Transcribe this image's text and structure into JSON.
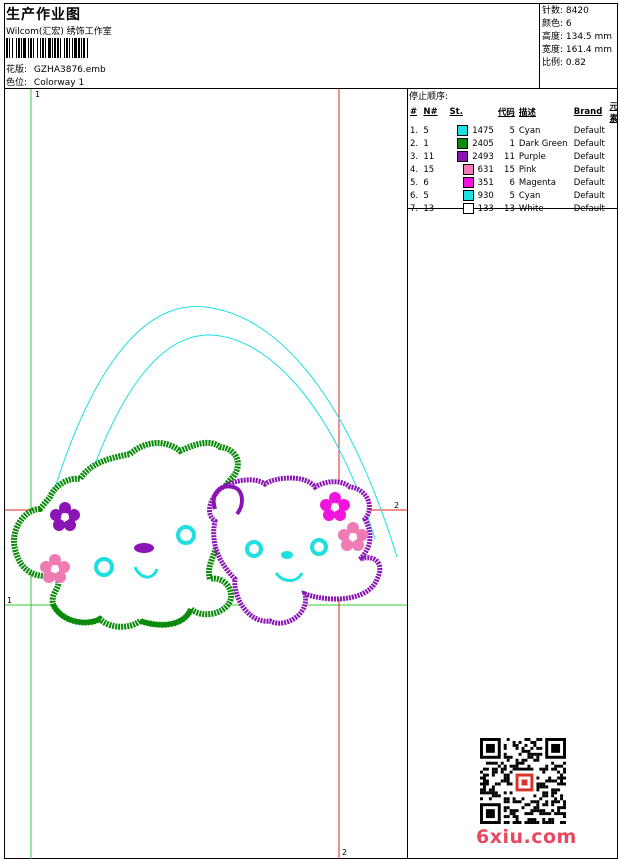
{
  "header": {
    "title": "生产作业图",
    "company": "Wilcom(汇宏) 绣饰工作室",
    "design_label": "花版:",
    "design_value": "GZHA3876.emb",
    "colorway_label": "色位:",
    "colorway_value": "Colorway 1"
  },
  "stats": {
    "stitches": "针数: 8420",
    "colors": "颜色: 6",
    "height": "高度: 134.5 mm",
    "width": "宽度: 161.4 mm",
    "scale": "比例: 0.82"
  },
  "stop_sequence": {
    "title": "停止顺序:",
    "headers": [
      "#",
      "N#",
      "St.",
      "代码",
      "描述",
      "Brand",
      "元素"
    ],
    "rows": [
      {
        "idx": "1.",
        "n": "5",
        "color": "#1ee0e0",
        "st": "1475",
        "code": "5",
        "desc": "Cyan",
        "brand": "Default"
      },
      {
        "idx": "2.",
        "n": "1",
        "color": "#0a8a0a",
        "st": "2405",
        "code": "1",
        "desc": "Dark Green",
        "brand": "Default"
      },
      {
        "idx": "3.",
        "n": "11",
        "color": "#8a14b4",
        "st": "2493",
        "code": "11",
        "desc": "Purple",
        "brand": "Default"
      },
      {
        "idx": "4.",
        "n": "15",
        "color": "#f07ab4",
        "st": "631",
        "code": "15",
        "desc": "Pink",
        "brand": "Default"
      },
      {
        "idx": "5.",
        "n": "6",
        "color": "#f014dc",
        "st": "351",
        "code": "6",
        "desc": "Magenta",
        "brand": "Default"
      },
      {
        "idx": "6.",
        "n": "5",
        "color": "#1ee0e0",
        "st": "930",
        "code": "5",
        "desc": "Cyan",
        "brand": "Default"
      },
      {
        "idx": "7.",
        "n": "13",
        "color": "#ffffff",
        "st": "133",
        "code": "13",
        "desc": "White",
        "brand": "Default"
      }
    ]
  },
  "guides": {
    "mark_1": "1",
    "mark_2": "2"
  },
  "watermark": "6xiu.com",
  "colors": {
    "guide_green": "#33cc33",
    "guide_red": "#ee2222",
    "thread_cyan": "#1ee0e0",
    "thread_green": "#0a8a0a",
    "thread_purple": "#8a14b4",
    "thread_pink": "#f07ab4",
    "thread_magenta": "#f014dc"
  }
}
